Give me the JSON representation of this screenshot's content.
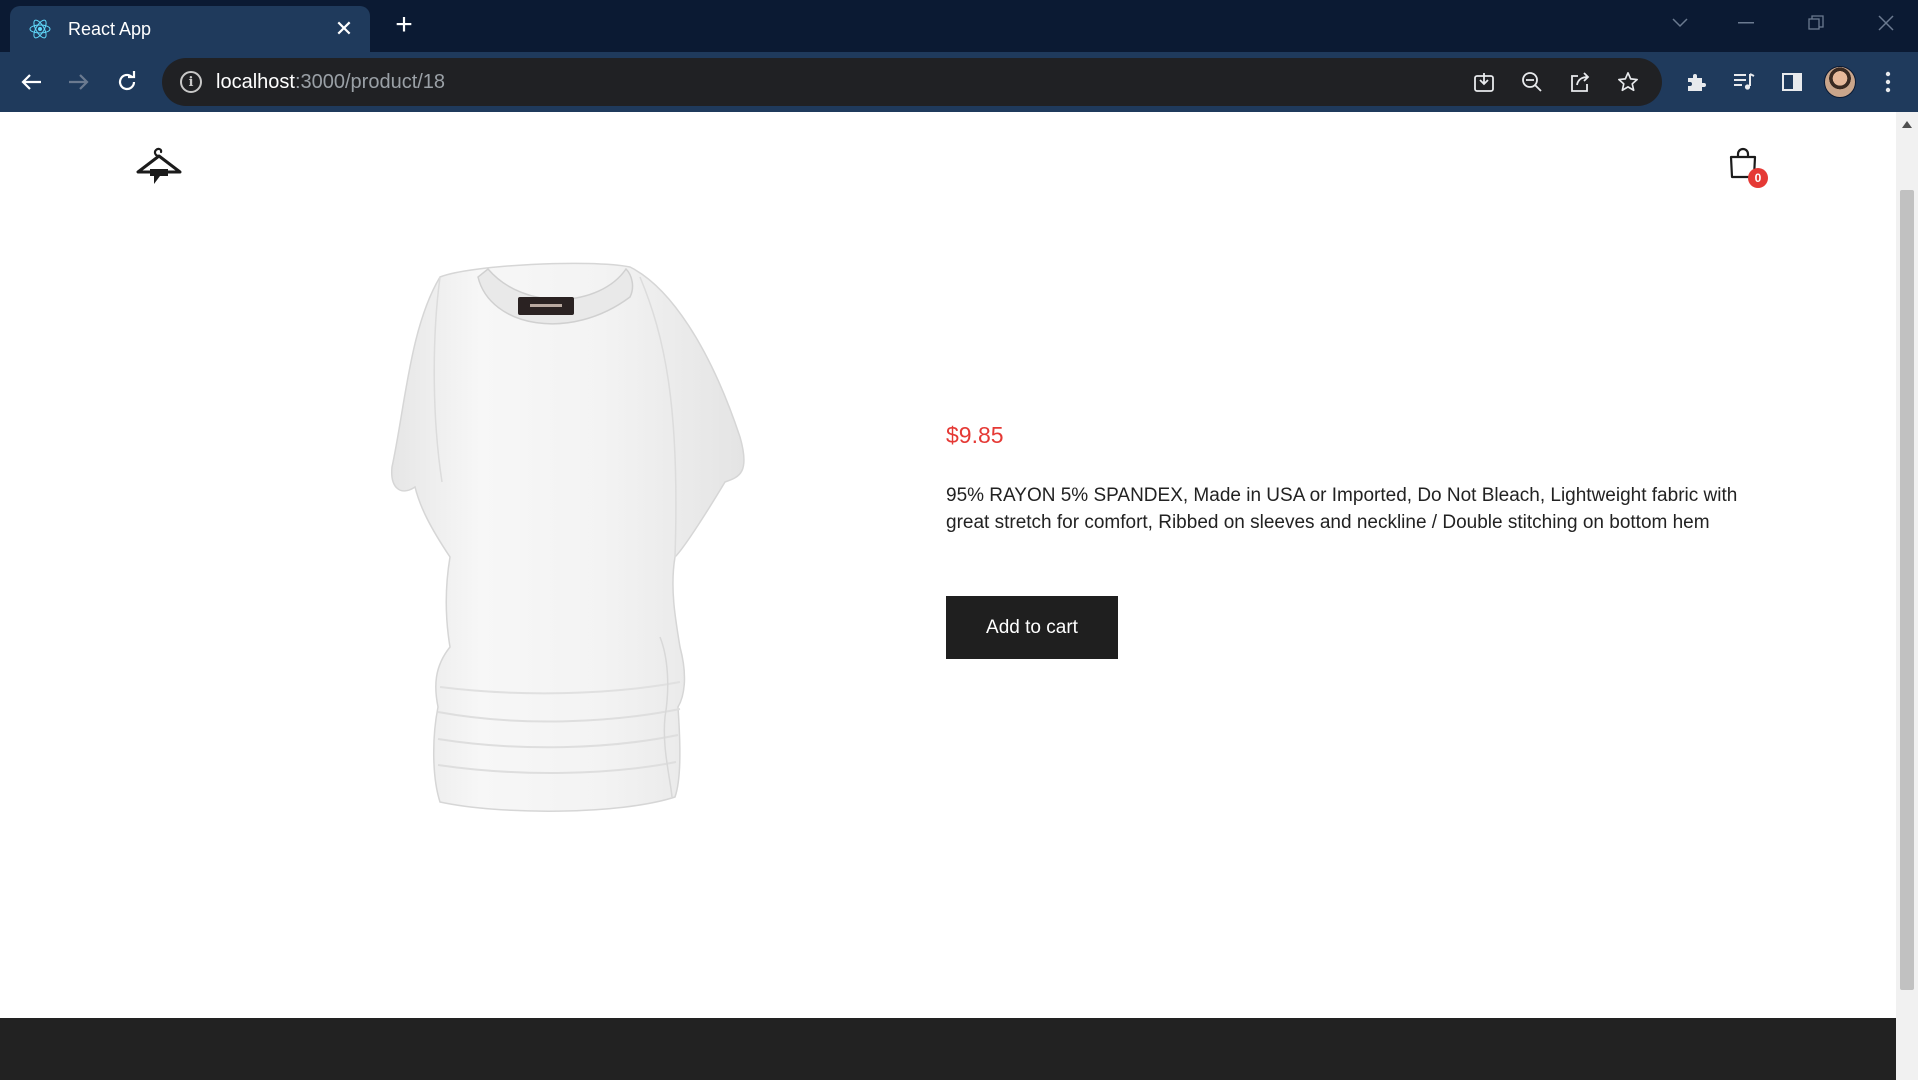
{
  "browser": {
    "tab_title": "React App",
    "tab_close": "✕",
    "new_tab": "+",
    "url_host": "localhost",
    "url_path": ":3000/product/18"
  },
  "icons": {
    "favicon": "react-icon",
    "back": "arrow-left-icon",
    "forward": "arrow-right-icon",
    "reload": "reload-icon",
    "info": "info-icon",
    "install": "install-icon",
    "zoom": "zoom-out-icon",
    "share": "share-icon",
    "bookmark": "star-icon",
    "extensions": "puzzle-icon",
    "media": "media-queue-icon",
    "side_panel": "side-panel-icon",
    "profile": "avatar",
    "menu": "kebab-menu-icon",
    "logo": "hanger-house-logo",
    "cart": "shopping-bag-icon"
  },
  "header": {
    "cart_count": "0"
  },
  "product": {
    "image_alt": "white t-shirt",
    "price": "$9.85",
    "description": "95% RAYON 5% SPANDEX, Made in USA or Imported, Do Not Bleach, Lightweight fabric with great stretch for comfort, Ribbed on sleeves and neckline / Double stitching on bottom hem",
    "add_to_cart_label": "Add to cart"
  },
  "colors": {
    "tabbar": "#0b1a33",
    "toolbar": "#1f3a5c",
    "price": "#e53935",
    "button": "#1f1f1f",
    "footer": "#222222"
  }
}
